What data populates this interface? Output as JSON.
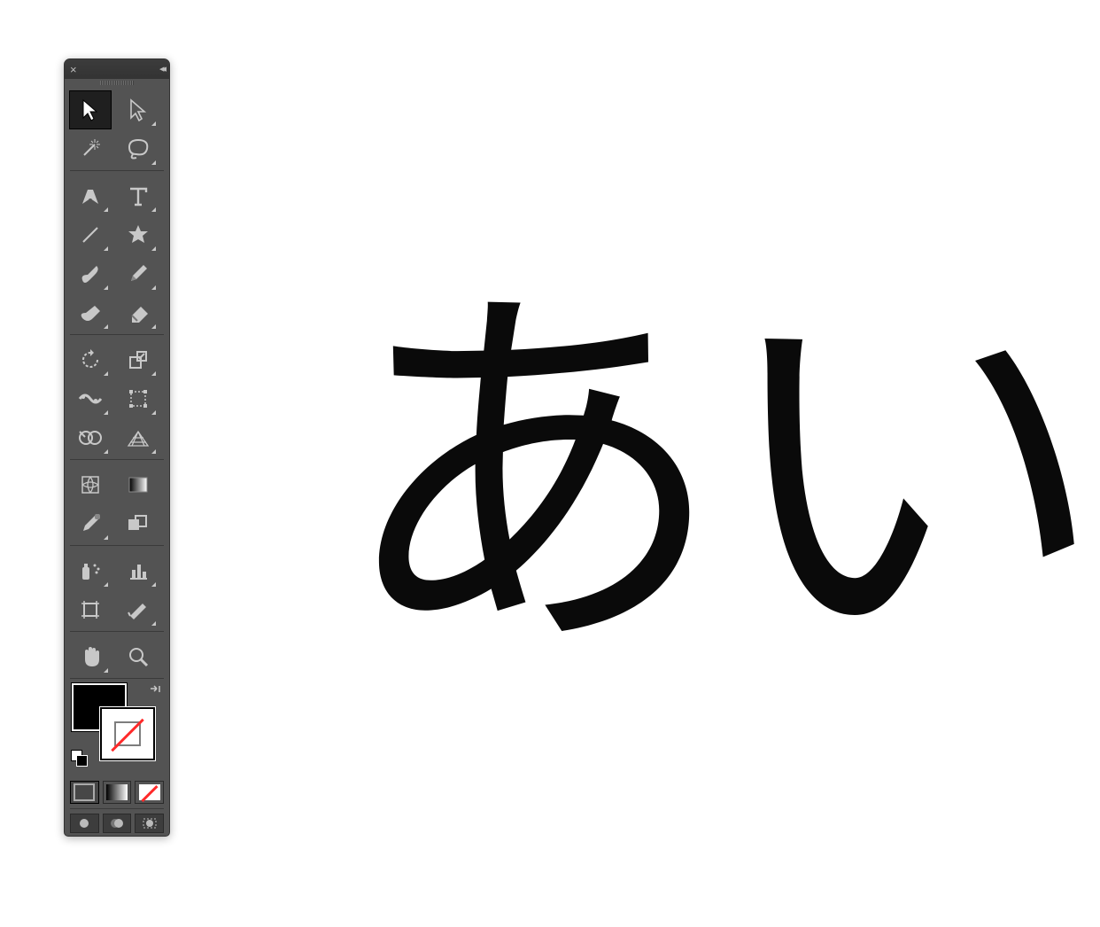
{
  "canvas": {
    "text": "あい"
  },
  "panel": {
    "close_label": "×",
    "collapse_label": "◂◂"
  },
  "tools": {
    "selection": {
      "name": "selection-tool",
      "interact": true,
      "flyout": false,
      "selected": true
    },
    "direct_selection": {
      "name": "direct-selection-tool",
      "interact": true,
      "flyout": true
    },
    "magic_wand": {
      "name": "magic-wand-tool",
      "interact": true,
      "flyout": false
    },
    "lasso": {
      "name": "lasso-tool",
      "interact": true,
      "flyout": true
    },
    "pen": {
      "name": "pen-tool",
      "interact": true,
      "flyout": true
    },
    "type": {
      "name": "type-tool",
      "interact": true,
      "flyout": true
    },
    "line": {
      "name": "line-segment-tool",
      "interact": true,
      "flyout": true
    },
    "shape": {
      "name": "shape-tool",
      "interact": true,
      "flyout": true
    },
    "paintbrush": {
      "name": "paintbrush-tool",
      "interact": true,
      "flyout": true
    },
    "pencil": {
      "name": "pencil-tool",
      "interact": true,
      "flyout": true
    },
    "blob": {
      "name": "blob-brush-tool",
      "interact": true,
      "flyout": true
    },
    "eraser": {
      "name": "eraser-tool",
      "interact": true,
      "flyout": true
    },
    "rotate": {
      "name": "rotate-tool",
      "interact": true,
      "flyout": true
    },
    "scale": {
      "name": "scale-tool",
      "interact": true,
      "flyout": true
    },
    "width": {
      "name": "width-tool",
      "interact": true,
      "flyout": true
    },
    "free_transform": {
      "name": "free-transform-tool",
      "interact": true,
      "flyout": true
    },
    "shape_builder": {
      "name": "shape-builder-tool",
      "interact": true,
      "flyout": true
    },
    "perspective": {
      "name": "perspective-grid-tool",
      "interact": true,
      "flyout": true
    },
    "mesh": {
      "name": "mesh-tool",
      "interact": true,
      "flyout": false
    },
    "gradient": {
      "name": "gradient-tool",
      "interact": true,
      "flyout": false
    },
    "eyedropper": {
      "name": "eyedropper-tool",
      "interact": true,
      "flyout": true
    },
    "blend": {
      "name": "blend-tool",
      "interact": true,
      "flyout": false
    },
    "symbol": {
      "name": "symbol-sprayer-tool",
      "interact": true,
      "flyout": true
    },
    "graph": {
      "name": "column-graph-tool",
      "interact": true,
      "flyout": true
    },
    "artboard": {
      "name": "artboard-tool",
      "interact": true,
      "flyout": false
    },
    "slice": {
      "name": "slice-tool",
      "interact": true,
      "flyout": true
    },
    "hand": {
      "name": "hand-tool",
      "interact": true,
      "flyout": true
    },
    "zoom": {
      "name": "zoom-tool",
      "interact": true,
      "flyout": false
    }
  },
  "color": {
    "fill": "#000000",
    "stroke": "none"
  },
  "draw_modes": [
    "color-mode",
    "gradient-mode",
    "none-mode"
  ],
  "screen_modes": [
    "draw-normal",
    "draw-behind",
    "draw-inside"
  ]
}
